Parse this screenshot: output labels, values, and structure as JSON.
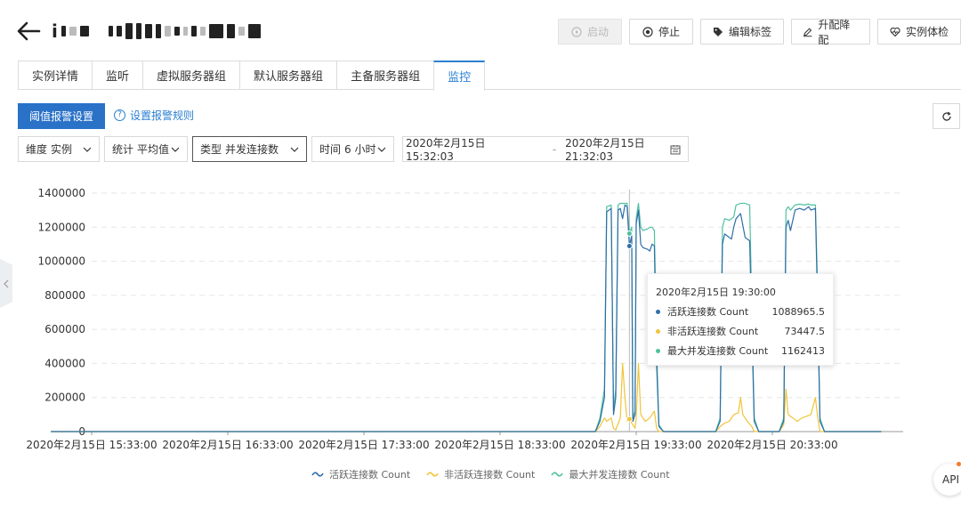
{
  "header": {
    "title_first_char": "i",
    "title_redacted": true
  },
  "actions": [
    {
      "name": "start-button",
      "label": "启动",
      "icon": "power-icon",
      "disabled": true
    },
    {
      "name": "stop-button",
      "label": "停止",
      "icon": "stop-circle-icon",
      "disabled": false
    },
    {
      "name": "edit-tags-button",
      "label": "编辑标签",
      "icon": "tag-icon",
      "disabled": false
    },
    {
      "name": "upgrade-downgrade-button",
      "label": "升配降配",
      "icon": "edit-icon",
      "disabled": false
    },
    {
      "name": "instance-check-button",
      "label": "实例体检",
      "icon": "heart-pulse-icon",
      "disabled": false
    }
  ],
  "tabs": [
    {
      "label": "实例详情",
      "active": false
    },
    {
      "label": "监听",
      "active": false
    },
    {
      "label": "虚拟服务器组",
      "active": false
    },
    {
      "label": "默认服务器组",
      "active": false
    },
    {
      "label": "主备服务器组",
      "active": false
    },
    {
      "label": "监控",
      "active": true
    }
  ],
  "controls": {
    "threshold_btn": "阈值报警设置",
    "rule_link": "设置报警规则",
    "filters": [
      {
        "label": "维度",
        "value": "实例"
      },
      {
        "label": "统计",
        "value": "平均值"
      },
      {
        "label": "类型",
        "value": "并发连接数"
      },
      {
        "label": "时间",
        "value": "6 小时"
      }
    ],
    "date_start": "2020年2月15日 15:32:03",
    "date_sep": "-",
    "date_end": "2020年2月15日 21:32:03"
  },
  "colors": {
    "accent": "#2a7fd0",
    "active": "#2e6ea8",
    "inactive": "#f0c43a",
    "max": "#4fc1a0"
  },
  "tooltip": {
    "time": "2020年2月15日 19:30:00",
    "rows": [
      {
        "name": "活跃连接数 Count",
        "value": "1088965.5",
        "color": "#2e6ea8"
      },
      {
        "name": "非活跃连接数 Count",
        "value": "73447.5",
        "color": "#f0c43a"
      },
      {
        "name": "最大并发连接数 Count",
        "value": "1162413",
        "color": "#4fc1a0"
      }
    ]
  },
  "api_label": "API",
  "chart_data": {
    "type": "line",
    "title": "",
    "xlabel": "",
    "ylabel": "",
    "ylim": [
      0,
      1400000
    ],
    "yticks": [
      "0",
      "200000",
      "400000",
      "600000",
      "800000",
      "1000000",
      "1200000",
      "1400000"
    ],
    "xticks": [
      {
        "minute": 0,
        "label": "2020年2月15日 15:33:00"
      },
      {
        "minute": 60,
        "label": "2020年2月15日 16:33:00"
      },
      {
        "minute": 120,
        "label": "2020年2月15日 17:33:00"
      },
      {
        "minute": 180,
        "label": "2020年2月15日 18:33:00"
      },
      {
        "minute": 240,
        "label": "2020年2月15日 19:33:00"
      },
      {
        "minute": 300,
        "label": "2020年2月15日 20:33:00"
      }
    ],
    "x_unit": "minutes after 2020年2月15日 15:33:00",
    "cursor_minute": 237,
    "legend_position": "bottom",
    "grid": true,
    "series": [
      {
        "name": "活跃连接数 Count",
        "color": "#2e6ea8",
        "points": [
          [
            -18,
            0
          ],
          [
            222,
            0
          ],
          [
            224,
            60000
          ],
          [
            226,
            200000
          ],
          [
            227,
            1290000
          ],
          [
            229,
            1310000
          ],
          [
            230,
            100000
          ],
          [
            231,
            200000
          ],
          [
            232,
            1300000
          ],
          [
            233,
            1310000
          ],
          [
            234,
            1250000
          ],
          [
            235,
            1330000
          ],
          [
            236,
            1320000
          ],
          [
            237,
            1088965
          ],
          [
            238,
            1150000
          ],
          [
            238.5,
            60000
          ],
          [
            239.5,
            100000
          ],
          [
            240,
            1220000
          ],
          [
            241,
            1300000
          ],
          [
            242,
            1100000
          ],
          [
            243,
            1080000
          ],
          [
            245,
            1070000
          ],
          [
            246,
            1060000
          ],
          [
            247,
            1100000
          ],
          [
            248,
            1090000
          ],
          [
            249,
            400000
          ],
          [
            250,
            30000
          ],
          [
            252,
            0
          ],
          [
            275,
            0
          ],
          [
            277,
            60000
          ],
          [
            278,
            1100000
          ],
          [
            279,
            1160000
          ],
          [
            280,
            1150000
          ],
          [
            282,
            1130000
          ],
          [
            283,
            1200000
          ],
          [
            284,
            1250000
          ],
          [
            286,
            1280000
          ],
          [
            288,
            1140000
          ],
          [
            290,
            1120000
          ],
          [
            291,
            600000
          ],
          [
            292,
            60000
          ],
          [
            294,
            0
          ],
          [
            303,
            0
          ],
          [
            305,
            60000
          ],
          [
            306,
            1200000
          ],
          [
            307,
            1240000
          ],
          [
            308,
            1180000
          ],
          [
            310,
            1300000
          ],
          [
            312,
            1310000
          ],
          [
            314,
            1300000
          ],
          [
            316,
            1320000
          ],
          [
            317,
            1300000
          ],
          [
            319,
            1310000
          ],
          [
            320,
            700000
          ],
          [
            321,
            60000
          ],
          [
            323,
            0
          ],
          [
            348,
            0
          ]
        ]
      },
      {
        "name": "非活跃连接数 Count",
        "color": "#f0c43a",
        "points": [
          [
            -18,
            0
          ],
          [
            222,
            0
          ],
          [
            224,
            30000
          ],
          [
            226,
            80000
          ],
          [
            227,
            60000
          ],
          [
            229,
            80000
          ],
          [
            230,
            20000
          ],
          [
            231,
            10000
          ],
          [
            233,
            80000
          ],
          [
            234,
            400000
          ],
          [
            235,
            200000
          ],
          [
            236,
            60000
          ],
          [
            237,
            73447
          ],
          [
            238,
            50000
          ],
          [
            239.5,
            20000
          ],
          [
            240,
            80000
          ],
          [
            241,
            400000
          ],
          [
            242,
            100000
          ],
          [
            244,
            60000
          ],
          [
            246,
            80000
          ],
          [
            248,
            120000
          ],
          [
            249,
            20000
          ],
          [
            250,
            0
          ],
          [
            275,
            0
          ],
          [
            277,
            30000
          ],
          [
            279,
            50000
          ],
          [
            281,
            60000
          ],
          [
            283,
            100000
          ],
          [
            285,
            110000
          ],
          [
            286,
            200000
          ],
          [
            287,
            100000
          ],
          [
            289,
            60000
          ],
          [
            291,
            30000
          ],
          [
            292,
            0
          ],
          [
            303,
            0
          ],
          [
            305,
            40000
          ],
          [
            306,
            250000
          ],
          [
            307,
            100000
          ],
          [
            309,
            80000
          ],
          [
            311,
            60000
          ],
          [
            313,
            80000
          ],
          [
            315,
            90000
          ],
          [
            317,
            100000
          ],
          [
            319,
            200000
          ],
          [
            320,
            80000
          ],
          [
            321,
            0
          ],
          [
            348,
            0
          ]
        ]
      },
      {
        "name": "最大并发连接数 Count",
        "color": "#4fc1a0",
        "points": [
          [
            -18,
            0
          ],
          [
            222,
            0
          ],
          [
            224,
            80000
          ],
          [
            226,
            250000
          ],
          [
            227,
            1320000
          ],
          [
            229,
            1330000
          ],
          [
            230,
            120000
          ],
          [
            231,
            250000
          ],
          [
            232,
            1330000
          ],
          [
            233,
            1340000
          ],
          [
            234,
            1340000
          ],
          [
            235,
            1340000
          ],
          [
            236,
            1340000
          ],
          [
            237,
            1162413
          ],
          [
            238,
            1200000
          ],
          [
            238.5,
            80000
          ],
          [
            239.5,
            120000
          ],
          [
            240,
            1250000
          ],
          [
            241,
            1340000
          ],
          [
            242,
            1200000
          ],
          [
            243,
            1180000
          ],
          [
            245,
            1190000
          ],
          [
            246,
            1200000
          ],
          [
            247,
            1200000
          ],
          [
            248,
            1180000
          ],
          [
            249,
            500000
          ],
          [
            250,
            40000
          ],
          [
            252,
            0
          ],
          [
            275,
            0
          ],
          [
            277,
            80000
          ],
          [
            278,
            1200000
          ],
          [
            279,
            1250000
          ],
          [
            281,
            1240000
          ],
          [
            283,
            1260000
          ],
          [
            284,
            1330000
          ],
          [
            286,
            1340000
          ],
          [
            288,
            1340000
          ],
          [
            290,
            1330000
          ],
          [
            291,
            700000
          ],
          [
            292,
            80000
          ],
          [
            294,
            0
          ],
          [
            303,
            0
          ],
          [
            305,
            80000
          ],
          [
            306,
            1300000
          ],
          [
            307,
            1320000
          ],
          [
            308,
            1300000
          ],
          [
            310,
            1330000
          ],
          [
            312,
            1335000
          ],
          [
            314,
            1330000
          ],
          [
            316,
            1335000
          ],
          [
            317,
            1330000
          ],
          [
            319,
            1330000
          ],
          [
            320,
            800000
          ],
          [
            321,
            80000
          ],
          [
            323,
            0
          ],
          [
            348,
            0
          ]
        ]
      }
    ]
  }
}
